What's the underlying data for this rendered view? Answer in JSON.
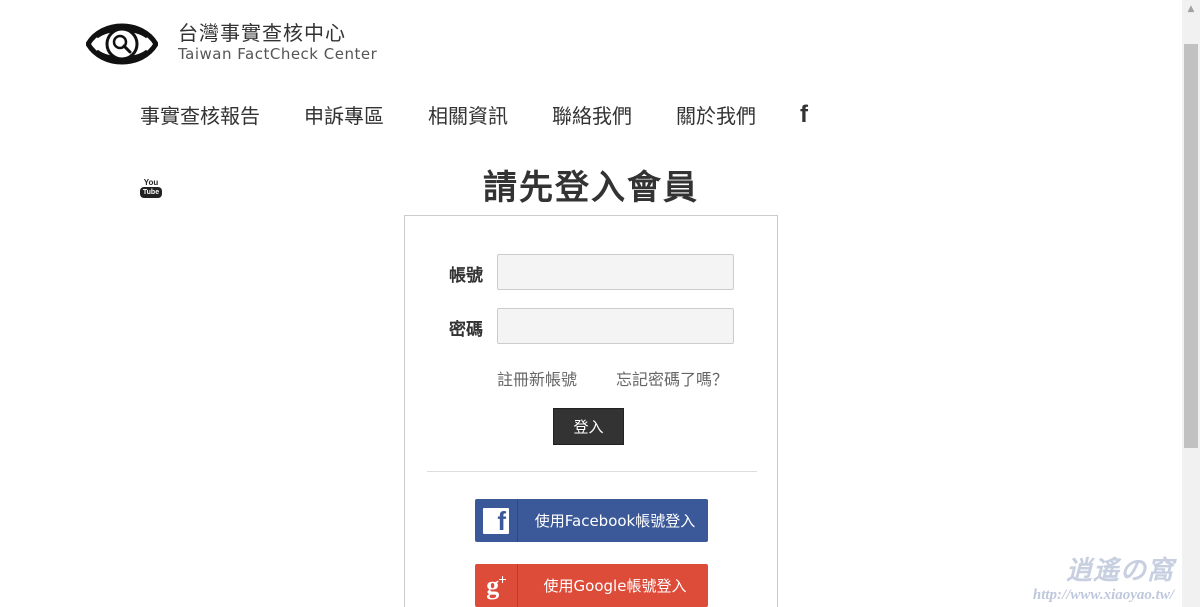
{
  "header": {
    "brand_zh": "台灣事實查核中心",
    "brand_en": "Taiwan FactCheck Center",
    "logo_icon": "eye-magnifier-icon"
  },
  "nav": {
    "items": [
      {
        "label": "事實查核報告"
      },
      {
        "label": "申訴專區"
      },
      {
        "label": "相關資訊"
      },
      {
        "label": "聯絡我們"
      },
      {
        "label": "關於我們"
      }
    ],
    "facebook_glyph": "f",
    "youtube_you": "You",
    "youtube_tube": "Tube"
  },
  "main": {
    "title": "請先登入會員",
    "account_label": "帳號",
    "password_label": "密碼",
    "account_value": "",
    "password_value": "",
    "register_link": "註冊新帳號",
    "forgot_link": "忘記密碼了嗎？",
    "login_button": "登入",
    "facebook_login": "使用Facebook帳號登入",
    "google_login": "使用Google帳號登入"
  },
  "colors": {
    "facebook_blue": "#3b5998",
    "google_red": "#dd4b39",
    "login_button": "#333333",
    "input_bg": "#f4f4f4"
  },
  "watermark": {
    "title": "逍遙の窩",
    "url": "http://www.xiaoyao.tw/"
  }
}
